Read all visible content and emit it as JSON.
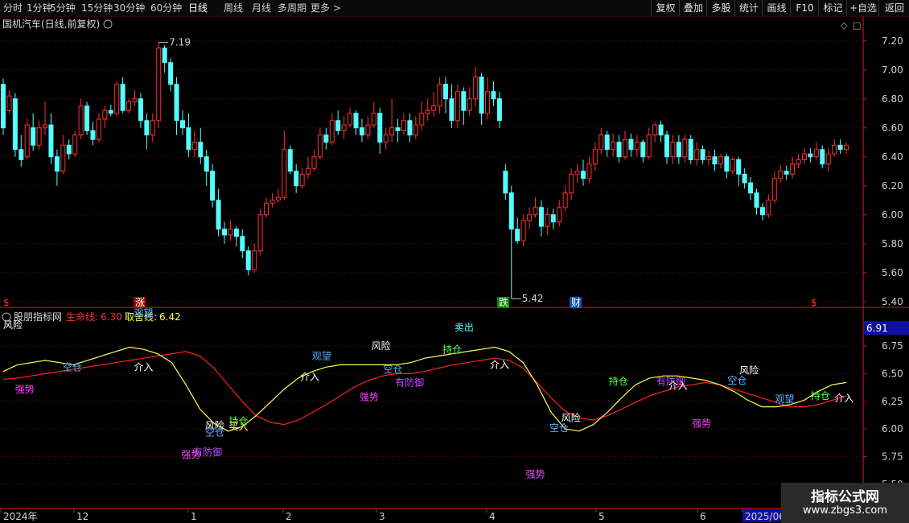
{
  "toolbar": {
    "left": [
      "分时",
      "1分钟",
      "5分钟",
      "15分钟",
      "30分钟",
      "60分钟",
      "日线",
      "周线",
      "月线",
      "多周期",
      "更多 >"
    ],
    "active": "日线",
    "right": [
      "复权",
      "叠加",
      "多股",
      "统计",
      "画线",
      "F10",
      "标记",
      "+自选",
      "返回"
    ]
  },
  "price_panel": {
    "title": "国机汽车(日线,前复权)",
    "high_label": "7.19",
    "low_label": "5.42",
    "markers": [
      "$",
      "涨",
      "跌",
      "财",
      "$"
    ],
    "yticks": [
      "7.20",
      "7.00",
      "6.80",
      "6.60",
      "6.40",
      "6.20",
      "6.00",
      "5.80",
      "5.60",
      "5.40"
    ]
  },
  "indicator_panel": {
    "name": "股朋指标网",
    "line1_label": "生命线:",
    "line1_value": "6.30",
    "line2_label": "取舍线:",
    "line2_value": "6.42",
    "current_value": "6.91",
    "yticks": [
      "6.75",
      "6.50",
      "6.25",
      "6.00",
      "5.75",
      "5.50"
    ]
  },
  "x_axis": {
    "labels": [
      "2024年",
      "12",
      "1",
      "2",
      "3",
      "4",
      "5",
      "6",
      "2025/06"
    ]
  },
  "watermark": {
    "line1": "指标公式网",
    "line2": "www.zbgs3.com"
  },
  "colors": {
    "up": "#ff3232",
    "down": "#54ffff",
    "lifeline": "#ff2020",
    "tradeline": "#ffff50",
    "grid": "#7a0000",
    "axis": "#cc2020"
  },
  "chart_data": {
    "type": "candlestick",
    "candles": [
      [
        6.9,
        6.6,
        6.94,
        6.55
      ],
      [
        6.72,
        6.82,
        6.86,
        6.7
      ],
      [
        6.8,
        6.45,
        6.84,
        6.4
      ],
      [
        6.45,
        6.38,
        6.55,
        6.33
      ],
      [
        6.4,
        6.62,
        6.66,
        6.38
      ],
      [
        6.6,
        6.48,
        6.7,
        6.44
      ],
      [
        6.48,
        6.6,
        6.65,
        6.45
      ],
      [
        6.6,
        6.62,
        6.78,
        6.55
      ],
      [
        6.62,
        6.4,
        6.7,
        6.35
      ],
      [
        6.4,
        6.3,
        6.45,
        6.2
      ],
      [
        6.3,
        6.48,
        6.55,
        6.28
      ],
      [
        6.48,
        6.42,
        6.52,
        6.38
      ],
      [
        6.42,
        6.55,
        6.58,
        6.4
      ],
      [
        6.55,
        6.75,
        6.8,
        6.52
      ],
      [
        6.75,
        6.58,
        6.78,
        6.55
      ],
      [
        6.58,
        6.52,
        6.64,
        6.48
      ],
      [
        6.52,
        6.66,
        6.7,
        6.5
      ],
      [
        6.66,
        6.72,
        6.75,
        6.6
      ],
      [
        6.72,
        6.7,
        6.76,
        6.68
      ],
      [
        6.7,
        6.9,
        6.92,
        6.68
      ],
      [
        6.9,
        6.72,
        6.95,
        6.7
      ],
      [
        6.72,
        6.78,
        6.8,
        6.7
      ],
      [
        6.78,
        6.8,
        6.86,
        6.75
      ],
      [
        6.8,
        6.65,
        6.84,
        6.6
      ],
      [
        6.65,
        6.55,
        6.7,
        6.45
      ],
      [
        6.55,
        6.65,
        6.7,
        6.5
      ],
      [
        6.65,
        7.15,
        7.19,
        6.6
      ],
      [
        7.15,
        7.05,
        7.17,
        6.98
      ],
      [
        7.05,
        6.9,
        7.08,
        6.85
      ],
      [
        6.9,
        6.65,
        6.95,
        6.55
      ],
      [
        6.65,
        6.6,
        6.72,
        6.55
      ],
      [
        6.6,
        6.45,
        6.7,
        6.4
      ],
      [
        6.45,
        6.5,
        6.58,
        6.4
      ],
      [
        6.5,
        6.4,
        6.6,
        6.35
      ],
      [
        6.4,
        6.3,
        6.45,
        6.2
      ],
      [
        6.3,
        6.1,
        6.35,
        6.05
      ],
      [
        6.1,
        5.9,
        6.18,
        5.85
      ],
      [
        5.9,
        5.86,
        5.95,
        5.8
      ],
      [
        5.86,
        5.9,
        5.96,
        5.82
      ],
      [
        5.9,
        5.85,
        5.92,
        5.78
      ],
      [
        5.85,
        5.75,
        5.9,
        5.7
      ],
      [
        5.75,
        5.62,
        5.78,
        5.58
      ],
      [
        5.62,
        5.75,
        5.8,
        5.6
      ],
      [
        5.75,
        6.0,
        6.04,
        5.72
      ],
      [
        6.0,
        6.08,
        6.12,
        5.98
      ],
      [
        6.08,
        6.1,
        6.15,
        6.05
      ],
      [
        6.1,
        6.12,
        6.18,
        6.08
      ],
      [
        6.12,
        6.45,
        6.58,
        6.1
      ],
      [
        6.45,
        6.3,
        6.48,
        6.28
      ],
      [
        6.3,
        6.2,
        6.35,
        6.15
      ],
      [
        6.2,
        6.28,
        6.32,
        6.18
      ],
      [
        6.28,
        6.32,
        6.4,
        6.25
      ],
      [
        6.32,
        6.4,
        6.45,
        6.3
      ],
      [
        6.4,
        6.55,
        6.6,
        6.38
      ],
      [
        6.55,
        6.5,
        6.6,
        6.45
      ],
      [
        6.5,
        6.65,
        6.7,
        6.48
      ],
      [
        6.65,
        6.58,
        6.72,
        6.55
      ],
      [
        6.58,
        6.62,
        6.68,
        6.52
      ],
      [
        6.62,
        6.7,
        6.74,
        6.6
      ],
      [
        6.7,
        6.6,
        6.72,
        6.55
      ],
      [
        6.6,
        6.55,
        6.66,
        6.5
      ],
      [
        6.55,
        6.62,
        6.68,
        6.52
      ],
      [
        6.62,
        6.7,
        6.78,
        6.6
      ],
      [
        6.7,
        6.5,
        6.74,
        6.42
      ],
      [
        6.5,
        6.55,
        6.6,
        6.45
      ],
      [
        6.55,
        6.6,
        6.8,
        6.5
      ],
      [
        6.6,
        6.58,
        6.66,
        6.5
      ],
      [
        6.58,
        6.65,
        6.7,
        6.55
      ],
      [
        6.65,
        6.55,
        6.7,
        6.5
      ],
      [
        6.55,
        6.62,
        6.68,
        6.52
      ],
      [
        6.62,
        6.7,
        6.78,
        6.58
      ],
      [
        6.7,
        6.72,
        6.8,
        6.65
      ],
      [
        6.72,
        6.75,
        6.85,
        6.68
      ],
      [
        6.75,
        6.9,
        6.95,
        6.7
      ],
      [
        6.9,
        6.8,
        6.95,
        6.7
      ],
      [
        6.8,
        6.65,
        6.9,
        6.6
      ],
      [
        6.65,
        6.85,
        6.9,
        6.6
      ],
      [
        6.85,
        6.72,
        6.88,
        6.62
      ],
      [
        6.72,
        6.8,
        6.88,
        6.68
      ],
      [
        6.8,
        6.95,
        7.02,
        6.75
      ],
      [
        6.95,
        6.7,
        6.98,
        6.62
      ],
      [
        6.7,
        6.85,
        6.95,
        6.66
      ],
      [
        6.85,
        6.8,
        6.92,
        6.75
      ],
      [
        6.8,
        6.65,
        6.85,
        6.6
      ],
      [
        6.3,
        6.15,
        6.35,
        6.1
      ],
      [
        6.15,
        5.9,
        6.2,
        5.42
      ],
      [
        5.9,
        5.82,
        5.98,
        5.8
      ],
      [
        5.82,
        5.96,
        6.0,
        5.78
      ],
      [
        5.96,
        6.0,
        6.05,
        5.9
      ],
      [
        6.0,
        6.05,
        6.12,
        5.98
      ],
      [
        6.05,
        5.92,
        6.1,
        5.85
      ],
      [
        5.92,
        6.0,
        6.05,
        5.86
      ],
      [
        6.0,
        5.95,
        6.04,
        5.9
      ],
      [
        5.95,
        6.05,
        6.1,
        5.92
      ],
      [
        6.05,
        6.15,
        6.2,
        6.02
      ],
      [
        6.15,
        6.28,
        6.32,
        6.1
      ],
      [
        6.28,
        6.3,
        6.35,
        6.22
      ],
      [
        6.3,
        6.25,
        6.38,
        6.2
      ],
      [
        6.25,
        6.35,
        6.4,
        6.22
      ],
      [
        6.35,
        6.45,
        6.5,
        6.3
      ],
      [
        6.45,
        6.55,
        6.6,
        6.42
      ],
      [
        6.55,
        6.45,
        6.58,
        6.4
      ],
      [
        6.45,
        6.5,
        6.56,
        6.4
      ],
      [
        6.5,
        6.4,
        6.55,
        6.36
      ],
      [
        6.4,
        6.52,
        6.58,
        6.38
      ],
      [
        6.52,
        6.45,
        6.56,
        6.4
      ],
      [
        6.45,
        6.5,
        6.55,
        6.4
      ],
      [
        6.5,
        6.4,
        6.52,
        6.36
      ],
      [
        6.4,
        6.55,
        6.6,
        6.38
      ],
      [
        6.55,
        6.62,
        6.64,
        6.5
      ],
      [
        6.62,
        6.55,
        6.65,
        6.5
      ],
      [
        6.55,
        6.4,
        6.58,
        6.35
      ],
      [
        6.4,
        6.5,
        6.55,
        6.35
      ],
      [
        6.5,
        6.4,
        6.55,
        6.35
      ],
      [
        6.4,
        6.52,
        6.55,
        6.36
      ],
      [
        6.52,
        6.38,
        6.55,
        6.35
      ],
      [
        6.38,
        6.45,
        6.5,
        6.34
      ],
      [
        6.45,
        6.38,
        6.48,
        6.35
      ],
      [
        6.38,
        6.4,
        6.44,
        6.34
      ],
      [
        6.4,
        6.35,
        6.45,
        6.3
      ],
      [
        6.35,
        6.4,
        6.42,
        6.32
      ],
      [
        6.4,
        6.3,
        6.42,
        6.25
      ],
      [
        6.3,
        6.38,
        6.4,
        6.28
      ],
      [
        6.38,
        6.28,
        6.4,
        6.2
      ],
      [
        6.28,
        6.22,
        6.32,
        6.18
      ],
      [
        6.22,
        6.15,
        6.26,
        6.1
      ],
      [
        6.15,
        6.05,
        6.18,
        6.0
      ],
      [
        6.05,
        6.0,
        6.08,
        5.96
      ],
      [
        6.0,
        6.1,
        6.14,
        5.98
      ],
      [
        6.1,
        6.25,
        6.3,
        6.08
      ],
      [
        6.25,
        6.3,
        6.34,
        6.22
      ],
      [
        6.3,
        6.28,
        6.34,
        6.24
      ],
      [
        6.28,
        6.35,
        6.4,
        6.25
      ],
      [
        6.35,
        6.38,
        6.42,
        6.32
      ],
      [
        6.38,
        6.42,
        6.46,
        6.35
      ],
      [
        6.42,
        6.4,
        6.46,
        6.36
      ],
      [
        6.4,
        6.45,
        6.5,
        6.38
      ],
      [
        6.45,
        6.35,
        6.48,
        6.32
      ],
      [
        6.35,
        6.42,
        6.46,
        6.3
      ],
      [
        6.42,
        6.48,
        6.52,
        6.4
      ],
      [
        6.48,
        6.45,
        6.52,
        6.42
      ],
      [
        6.45,
        6.48,
        6.5,
        6.42
      ]
    ],
    "series": [
      {
        "name": "生命线",
        "values": [
          6.45,
          6.46,
          6.48,
          6.5,
          6.52,
          6.54,
          6.56,
          6.58,
          6.6,
          6.62,
          6.64,
          6.66,
          6.68,
          6.7,
          6.66,
          6.55,
          6.4,
          6.25,
          6.12,
          6.06,
          6.04,
          6.08,
          6.15,
          6.22,
          6.3,
          6.38,
          6.44,
          6.48,
          6.5,
          6.5,
          6.52,
          6.55,
          6.58,
          6.6,
          6.62,
          6.64,
          6.62,
          6.55,
          6.42,
          6.28,
          6.16,
          6.1,
          6.08,
          6.12,
          6.18,
          6.24,
          6.3,
          6.34,
          6.38,
          6.4,
          6.42,
          6.4,
          6.36,
          6.32,
          6.28,
          6.24,
          6.2,
          6.2,
          6.22,
          6.26,
          6.3
        ]
      },
      {
        "name": "取舍线",
        "values": [
          6.52,
          6.58,
          6.6,
          6.62,
          6.6,
          6.58,
          6.62,
          6.66,
          6.7,
          6.74,
          6.72,
          6.68,
          6.6,
          6.4,
          6.18,
          6.05,
          5.98,
          6.02,
          6.12,
          6.24,
          6.36,
          6.46,
          6.52,
          6.56,
          6.58,
          6.58,
          6.58,
          6.58,
          6.58,
          6.6,
          6.64,
          6.66,
          6.68,
          6.7,
          6.72,
          6.74,
          6.7,
          6.6,
          6.4,
          6.15,
          6.0,
          5.98,
          6.04,
          6.15,
          6.28,
          6.4,
          6.46,
          6.48,
          6.48,
          6.46,
          6.44,
          6.4,
          6.34,
          6.26,
          6.2,
          6.2,
          6.22,
          6.26,
          6.34,
          6.4,
          6.42
        ]
      }
    ],
    "signals": [
      {
        "text": "风险",
        "x": 0,
        "y": 6.91,
        "color": "#ffffff"
      },
      {
        "text": "观望",
        "x": 11,
        "y": 7.02,
        "color": "#5ab0ff"
      },
      {
        "text": "空仓",
        "x": 5,
        "y": 6.53,
        "color": "#5ab0ff"
      },
      {
        "text": "介入",
        "x": 11,
        "y": 6.53,
        "color": "#ffffff"
      },
      {
        "text": "强势",
        "x": 1,
        "y": 6.33,
        "color": "#ff40ff"
      },
      {
        "text": "风险",
        "x": 17,
        "y": 6.0,
        "color": "#ffffff"
      },
      {
        "text": "空仓",
        "x": 17,
        "y": 5.94,
        "color": "#5ab0ff"
      },
      {
        "text": "强势",
        "x": 15,
        "y": 5.74,
        "color": "#ff40ff"
      },
      {
        "text": "有防御",
        "x": 16,
        "y": 5.76,
        "color": "#c050ff"
      },
      {
        "text": "持仓",
        "x": 19,
        "y": 6.04,
        "color": "#50ff50"
      },
      {
        "text": "买入",
        "x": 19,
        "y": 5.99,
        "color": "#ffff50"
      },
      {
        "text": "介入",
        "x": 25,
        "y": 6.44,
        "color": "#ffffff"
      },
      {
        "text": "观望",
        "x": 26,
        "y": 6.63,
        "color": "#5ab0ff"
      },
      {
        "text": "风险",
        "x": 31,
        "y": 6.72,
        "color": "#ffffff"
      },
      {
        "text": "空仓",
        "x": 32,
        "y": 6.51,
        "color": "#5ab0ff"
      },
      {
        "text": "有防御",
        "x": 33,
        "y": 6.39,
        "color": "#c050ff"
      },
      {
        "text": "强势",
        "x": 30,
        "y": 6.26,
        "color": "#ff40ff"
      },
      {
        "text": "持仓",
        "x": 37,
        "y": 6.69,
        "color": "#50ff50"
      },
      {
        "text": "卖出",
        "x": 38,
        "y": 6.89,
        "color": "#54ffff"
      },
      {
        "text": "介入",
        "x": 41,
        "y": 6.55,
        "color": "#ffffff"
      },
      {
        "text": "强势",
        "x": 44,
        "y": 5.56,
        "color": "#ff40ff"
      },
      {
        "text": "风险",
        "x": 47,
        "y": 6.07,
        "color": "#ffffff"
      },
      {
        "text": "空仓",
        "x": 46,
        "y": 5.98,
        "color": "#5ab0ff"
      },
      {
        "text": "持仓",
        "x": 51,
        "y": 6.4,
        "color": "#50ff50"
      },
      {
        "text": "有防御",
        "x": 55,
        "y": 6.4,
        "color": "#c050ff"
      },
      {
        "text": "介入",
        "x": 56,
        "y": 6.36,
        "color": "#ffffff"
      },
      {
        "text": "强势",
        "x": 58,
        "y": 6.02,
        "color": "#ff40ff"
      },
      {
        "text": "风险",
        "x": 62,
        "y": 6.5,
        "color": "#ffffff"
      },
      {
        "text": "空仓",
        "x": 61,
        "y": 6.41,
        "color": "#5ab0ff"
      },
      {
        "text": "观望",
        "x": 65,
        "y": 6.24,
        "color": "#5ab0ff"
      },
      {
        "text": "持仓",
        "x": 68,
        "y": 6.27,
        "color": "#50ff50"
      },
      {
        "text": "介入",
        "x": 70,
        "y": 6.25,
        "color": "#ffffff"
      }
    ],
    "price_ylim": [
      5.36,
      7.26
    ],
    "indicator_ylim": [
      5.28,
      7.1
    ],
    "indicator_points": 61,
    "signal_xmax": 71
  }
}
